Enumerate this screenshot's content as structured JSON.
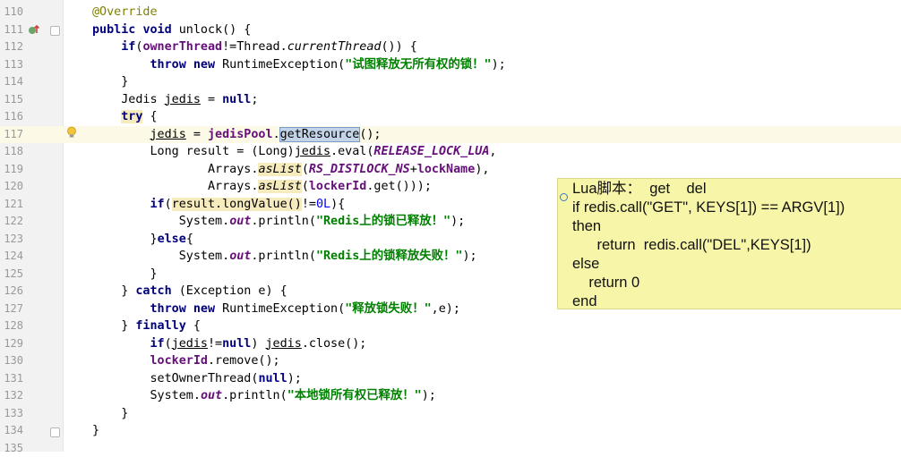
{
  "editor": {
    "lines": [
      {
        "no": "110",
        "segs": [
          {
            "t": "@Override",
            "c": "ann"
          }
        ]
      },
      {
        "no": "111",
        "segs": [
          {
            "t": "public ",
            "c": "kw"
          },
          {
            "t": "void ",
            "c": "kw"
          },
          {
            "t": "unlock() {"
          }
        ]
      },
      {
        "no": "112",
        "segs": [
          {
            "t": "    "
          },
          {
            "t": "if",
            "c": "kw"
          },
          {
            "t": "("
          },
          {
            "t": "ownerThread",
            "c": "fld"
          },
          {
            "t": "!=Thread."
          },
          {
            "t": "currentThread",
            "c": "ital"
          },
          {
            "t": "()) {"
          }
        ]
      },
      {
        "no": "113",
        "segs": [
          {
            "t": "        "
          },
          {
            "t": "throw ",
            "c": "kw"
          },
          {
            "t": "new ",
            "c": "kw"
          },
          {
            "t": "RuntimeException("
          },
          {
            "t": "\"试图释放无所有权的锁！\"",
            "c": "str"
          },
          {
            "t": ");"
          }
        ]
      },
      {
        "no": "114",
        "segs": [
          {
            "t": "    }"
          }
        ]
      },
      {
        "no": "115",
        "segs": [
          {
            "t": "    Jedis "
          },
          {
            "t": "jedis",
            "c": "ul"
          },
          {
            "t": " = "
          },
          {
            "t": "null",
            "c": "kw"
          },
          {
            "t": ";"
          }
        ]
      },
      {
        "no": "116",
        "segs": [
          {
            "t": "    "
          },
          {
            "t": "try",
            "c": "kw hl"
          },
          {
            "t": " {"
          }
        ]
      },
      {
        "no": "117",
        "cur": true,
        "segs": [
          {
            "t": "        "
          },
          {
            "t": "jedis",
            "c": "ul"
          },
          {
            "t": " = "
          },
          {
            "t": "jedisPool",
            "c": "fld"
          },
          {
            "t": "."
          },
          {
            "t": "getResource",
            "c": "sel"
          },
          {
            "t": "();"
          }
        ]
      },
      {
        "no": "118",
        "segs": [
          {
            "t": "        Long result = (Long)"
          },
          {
            "t": "jedis",
            "c": "ul"
          },
          {
            "t": ".eval("
          },
          {
            "t": "RELEASE_LOCK_LUA",
            "c": "fld ital"
          },
          {
            "t": ","
          }
        ]
      },
      {
        "no": "119",
        "segs": [
          {
            "t": "                Arrays."
          },
          {
            "t": "asList",
            "c": "ital hl"
          },
          {
            "t": "("
          },
          {
            "t": "RS_DISTLOCK_NS",
            "c": "fld ital"
          },
          {
            "t": "+"
          },
          {
            "t": "lockName",
            "c": "fld"
          },
          {
            "t": "),"
          }
        ]
      },
      {
        "no": "120",
        "segs": [
          {
            "t": "                Arrays."
          },
          {
            "t": "asList",
            "c": "ital hl"
          },
          {
            "t": "("
          },
          {
            "t": "lockerId",
            "c": "fld"
          },
          {
            "t": ".get()));"
          }
        ]
      },
      {
        "no": "121",
        "segs": [
          {
            "t": "        "
          },
          {
            "t": "if",
            "c": "kw"
          },
          {
            "t": "("
          },
          {
            "t": "result.longValue()",
            "c": "hl"
          },
          {
            "t": "!="
          },
          {
            "t": "0L",
            "c": "num"
          },
          {
            "t": "){"
          }
        ]
      },
      {
        "no": "122",
        "segs": [
          {
            "t": "            System."
          },
          {
            "t": "out",
            "c": "fld ital"
          },
          {
            "t": ".println("
          },
          {
            "t": "\"Redis上的锁已释放！\"",
            "c": "str"
          },
          {
            "t": ");"
          }
        ]
      },
      {
        "no": "123",
        "segs": [
          {
            "t": "        }"
          },
          {
            "t": "else",
            "c": "kw"
          },
          {
            "t": "{"
          }
        ]
      },
      {
        "no": "124",
        "segs": [
          {
            "t": "            System."
          },
          {
            "t": "out",
            "c": "fld ital"
          },
          {
            "t": ".println("
          },
          {
            "t": "\"Redis上的锁释放失败！\"",
            "c": "str"
          },
          {
            "t": ");"
          }
        ]
      },
      {
        "no": "125",
        "segs": [
          {
            "t": "        }"
          }
        ]
      },
      {
        "no": "126",
        "segs": [
          {
            "t": "    } "
          },
          {
            "t": "catch ",
            "c": "kw"
          },
          {
            "t": "(Exception e) {"
          }
        ]
      },
      {
        "no": "127",
        "segs": [
          {
            "t": "        "
          },
          {
            "t": "throw ",
            "c": "kw"
          },
          {
            "t": "new ",
            "c": "kw"
          },
          {
            "t": "RuntimeException("
          },
          {
            "t": "\"释放锁失败！\"",
            "c": "str"
          },
          {
            "t": ",e);"
          }
        ]
      },
      {
        "no": "128",
        "segs": [
          {
            "t": "    } "
          },
          {
            "t": "finally ",
            "c": "kw"
          },
          {
            "t": "{"
          }
        ]
      },
      {
        "no": "129",
        "segs": [
          {
            "t": "        "
          },
          {
            "t": "if",
            "c": "kw"
          },
          {
            "t": "("
          },
          {
            "t": "jedis",
            "c": "ul"
          },
          {
            "t": "!="
          },
          {
            "t": "null",
            "c": "kw"
          },
          {
            "t": ") "
          },
          {
            "t": "jedis",
            "c": "ul"
          },
          {
            "t": ".close();"
          }
        ]
      },
      {
        "no": "130",
        "segs": [
          {
            "t": "        "
          },
          {
            "t": "lockerId",
            "c": "fld"
          },
          {
            "t": ".remove();"
          }
        ]
      },
      {
        "no": "131",
        "segs": [
          {
            "t": "        setOwnerThread("
          },
          {
            "t": "null",
            "c": "kw"
          },
          {
            "t": ");"
          }
        ]
      },
      {
        "no": "132",
        "segs": [
          {
            "t": "        System."
          },
          {
            "t": "out",
            "c": "fld ital"
          },
          {
            "t": ".println("
          },
          {
            "t": "\"本地锁所有权已释放！\"",
            "c": "str"
          },
          {
            "t": ");"
          }
        ]
      },
      {
        "no": "133",
        "segs": [
          {
            "t": "    }"
          }
        ]
      },
      {
        "no": "134",
        "segs": [
          {
            "t": "}"
          }
        ]
      },
      {
        "no": "135",
        "segs": []
      }
    ]
  },
  "popup": {
    "lines": [
      "Lua脚本：  get    del",
      "if redis.call(\"GET\", KEYS[1]) == ARGV[1])",
      "then",
      "      return  redis.call(\"DEL\",KEYS[1])",
      "else",
      "    return 0",
      "end"
    ]
  },
  "icons": {
    "override_marker": "override-up-arrow-icon",
    "intention_bulb": "lightbulb-icon"
  },
  "colors": {
    "keyword": "#000080",
    "string": "#008000",
    "field": "#660e7a",
    "annotation": "#808000",
    "popup_bg": "#f6f5a8"
  }
}
